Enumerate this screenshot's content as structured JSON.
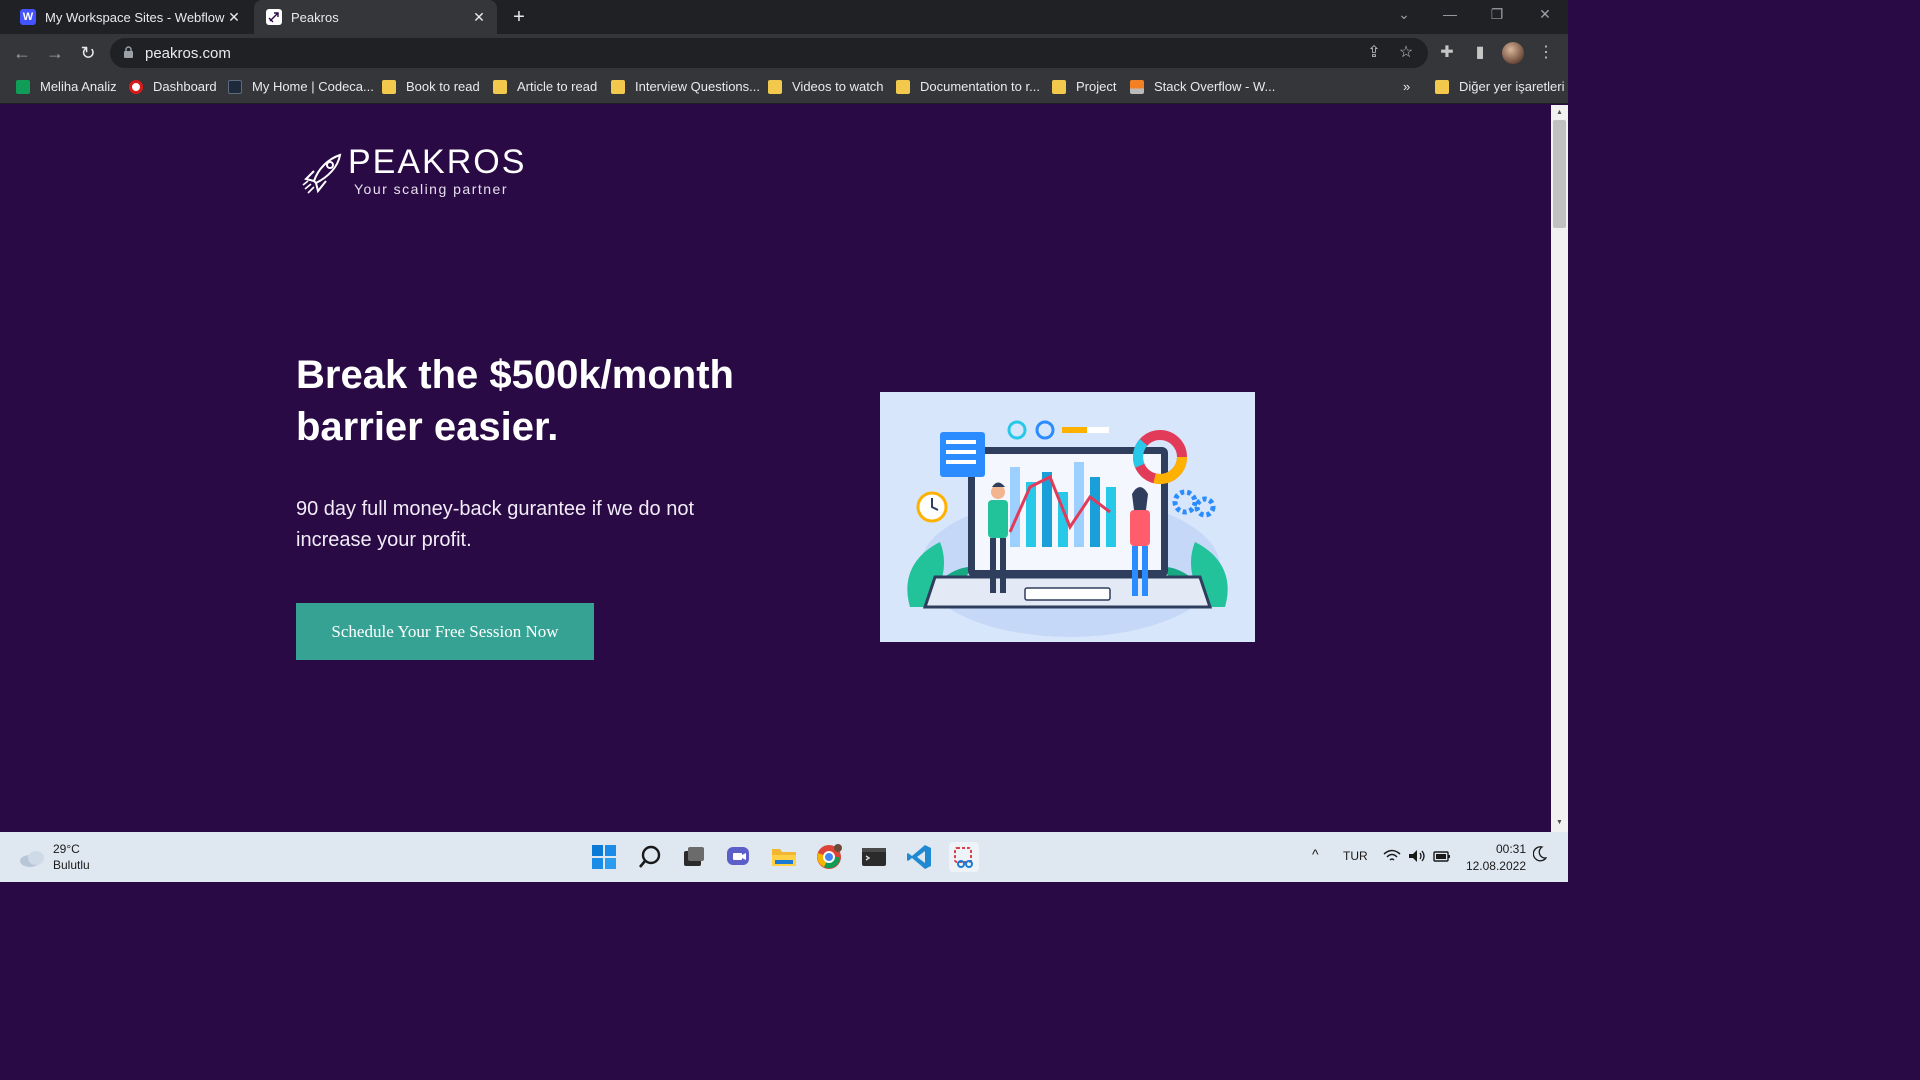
{
  "browser": {
    "tabs": [
      {
        "title": "My Workspace Sites - Webflow",
        "icon": "webflow-icon"
      },
      {
        "title": "Peakros",
        "icon": "rocket-icon",
        "active": true
      }
    ],
    "url": "peakros.com",
    "bookmarks": [
      {
        "label": "Meliha Analiz",
        "icon": "sheets-icon"
      },
      {
        "label": "Dashboard",
        "icon": "opera-icon"
      },
      {
        "label": "My Home | Codeca...",
        "icon": "codecademy-icon"
      },
      {
        "label": "Book to read",
        "icon": "folder-icon"
      },
      {
        "label": "Article to read",
        "icon": "folder-icon"
      },
      {
        "label": "Interview Questions...",
        "icon": "folder-icon"
      },
      {
        "label": "Videos to watch",
        "icon": "folder-icon"
      },
      {
        "label": "Documentation to r...",
        "icon": "folder-icon"
      },
      {
        "label": "Project",
        "icon": "folder-icon"
      },
      {
        "label": "Stack Overflow - W...",
        "icon": "stackoverflow-icon"
      }
    ],
    "bookmarks_overflow": "»",
    "other_bookmarks": "Diğer yer işaretleri"
  },
  "page": {
    "logo_name": "PEAKROS",
    "logo_tagline": "Your scaling partner",
    "headline": "Break the $500k/month barrier easier.",
    "subtext": "90 day full money-back gurantee if we do not increase your profit.",
    "cta_label": "Schedule Your Free Session Now"
  },
  "taskbar": {
    "weather_temp": "29°C",
    "weather_desc": "Bulutlu",
    "language": "TUR",
    "time": "00:31",
    "date": "12.08.2022"
  },
  "colors": {
    "page_bg": "#2a0a45",
    "cta_bg": "#35a293",
    "chrome_dark": "#202124",
    "chrome_tab": "#35363a"
  }
}
